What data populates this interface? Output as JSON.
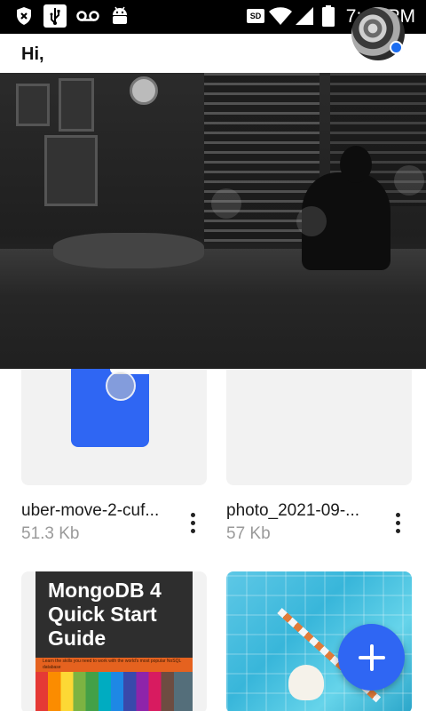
{
  "status_bar": {
    "time": "7:44 PM",
    "sd_label": "SD",
    "icons": [
      "shield-x-icon",
      "usb-icon",
      "voicemail-icon",
      "android-icon",
      "sd-card-icon",
      "wifi-icon",
      "signal-icon",
      "battery-icon"
    ]
  },
  "header": {
    "greeting": "Hi,"
  },
  "files": [
    {
      "name": "uber-move-2-cuf...",
      "size": "51.3 Kb",
      "thumb": "document"
    },
    {
      "name": "photo_2021-09-...",
      "size": "57 Kb",
      "thumb": "blank"
    },
    {
      "name": "",
      "size": "",
      "thumb": "book-cover",
      "cover_text": "MongoDB 4 Quick Start Guide",
      "cover_subtext": "Learn the skills you need to work with the world's most popular NoSQL database"
    },
    {
      "name": "",
      "size": "",
      "thumb": "pool-illustration"
    }
  ],
  "fab": {
    "icon": "plus-icon"
  },
  "colors": {
    "accent": "#2f66f3",
    "notification_dot": "#1a6cf0",
    "secondary_text": "#9a9a9a",
    "card_bg": "#f2f2f2"
  }
}
